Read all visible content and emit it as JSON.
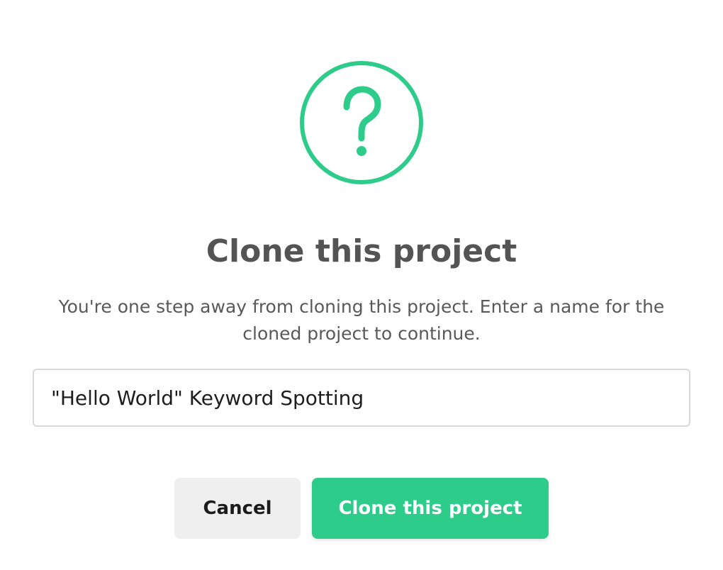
{
  "dialog": {
    "icon": "question-mark-icon",
    "title": "Clone this project",
    "message": "You're one step away from cloning this project. Enter a name for the cloned project to continue.",
    "input": {
      "value": "\"Hello World\" Keyword Spotting"
    },
    "buttons": {
      "cancel_label": "Cancel",
      "confirm_label": "Clone this project"
    }
  },
  "colors": {
    "accent": "#2ecc8a",
    "title_text": "#545454",
    "body_text": "#595959",
    "cancel_bg": "#efefef"
  }
}
